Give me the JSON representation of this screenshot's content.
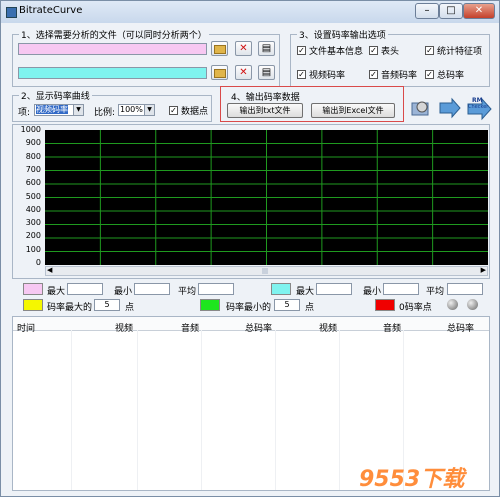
{
  "window": {
    "title": "BitrateCurve"
  },
  "file_group": {
    "label": "1、选择需要分析的文件（可以同时分析两个）",
    "file1": {
      "color": "#f7c8f2"
    },
    "file2": {
      "color": "#7ff3ef"
    }
  },
  "options_group": {
    "label": "3、设置码率输出选项",
    "checks": [
      {
        "label": "文件基本信息",
        "checked": true
      },
      {
        "label": "表头",
        "checked": true
      },
      {
        "label": "统计特征项",
        "checked": true
      },
      {
        "label": "视频码率",
        "checked": true
      },
      {
        "label": "音频码率",
        "checked": true
      },
      {
        "label": "总码率",
        "checked": true
      }
    ]
  },
  "display_group": {
    "label": "2、显示码率曲线",
    "item_label": "项:",
    "item_value": "视频码率",
    "ratio_label": "比例:",
    "ratio_value": "100%",
    "points_label": "数据点",
    "points_checked": true
  },
  "export_group": {
    "label": "4、输出码率数据",
    "txt_button": "输出到txt文件",
    "excel_button": "输出到Excel文件"
  },
  "toolbar": {
    "rm_label": "RM",
    "checker_label": "Checker"
  },
  "chart": {
    "y_ticks": [
      "1000",
      "900",
      "800",
      "700",
      "600",
      "500",
      "400",
      "300",
      "200",
      "100",
      "0"
    ],
    "bg": "#000000",
    "grid": "#1f9a1f"
  },
  "stats": {
    "row1": {
      "max": "最大",
      "min": "最小",
      "avg": "平均",
      "max2": "最大",
      "min2": "最小",
      "avg2": "平均",
      "swatch1": "#f7c8f2",
      "swatch2": "#7ff3ef"
    },
    "row2": {
      "max_points_label": "码率最大的",
      "max_points": "5",
      "points_unit": "点",
      "min_points_label": "码率最小的",
      "min_points": "5",
      "points_unit2": "点",
      "zero_label": "0码率点",
      "swatch_yellow": "#f5f700",
      "swatch_green": "#1ee61e",
      "swatch_red": "#f00000"
    }
  },
  "table": {
    "columns": [
      "时间",
      "视频",
      "音频",
      "总码率",
      "视频",
      "音频",
      "总码率"
    ]
  },
  "watermark": {
    "text": "9553下载"
  }
}
